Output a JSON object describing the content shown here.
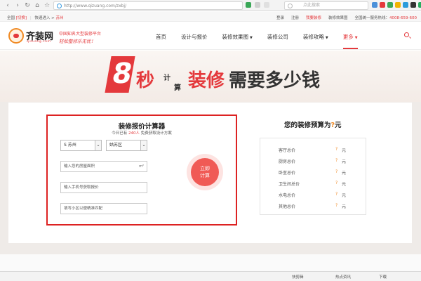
{
  "browser": {
    "url": "http://www.qizuang.com/zxbj/",
    "search_placeholder": "点此搜索"
  },
  "topbar": {
    "city": "全国",
    "switch": "[切换]",
    "quick_entry": "快速进入 >",
    "quick_city": "苏州",
    "links": [
      "登录",
      "注册",
      "我要装修",
      "装修效果图"
    ],
    "hotline_label": "全国统一服务热线：",
    "hotline": "4008-659-600"
  },
  "header": {
    "logo_name": "齐装网",
    "logo_domain": "qizuang.com",
    "slogan_line1": "中国知名大型装修平台",
    "slogan_line2": "轻松整修乐无忧！",
    "nav": [
      {
        "label": "首页",
        "dropdown": false
      },
      {
        "label": "设计与报价",
        "dropdown": false
      },
      {
        "label": "装修效果图",
        "dropdown": true
      },
      {
        "label": "装修公司",
        "dropdown": false
      },
      {
        "label": "装修攻略",
        "dropdown": true
      },
      {
        "label": "更多",
        "dropdown": true
      }
    ]
  },
  "hero": {
    "number": "8",
    "miao": "秒",
    "ji": "计",
    "suan": "算",
    "zhuangxiu": "装修",
    "rest": "需要多少钱"
  },
  "calculator": {
    "title": "装修报价计算器",
    "sub_prefix": "今日已有",
    "sub_count": "240人",
    "sub_suffix": "免费获取设计方案",
    "province": "S 苏州",
    "district": "姑苏区",
    "area_placeholder": "输入您的房屋面积",
    "area_unit": "m²",
    "phone_placeholder": "输入手机号获取报价",
    "community_placeholder": "填写小区以便精准匹配",
    "button_line1": "立即",
    "button_line2": "计算"
  },
  "budget": {
    "title_prefix": "您的装修预算为",
    "title_value": "?",
    "title_unit": "元",
    "rows": [
      {
        "label": "客厅总价",
        "value": "?",
        "unit": "元"
      },
      {
        "label": "厨房总价",
        "value": "?",
        "unit": "元"
      },
      {
        "label": "卧室总价",
        "value": "?",
        "unit": "元"
      },
      {
        "label": "卫生间总价",
        "value": "?",
        "unit": "元"
      },
      {
        "label": "水电总价",
        "value": "?",
        "unit": "元"
      },
      {
        "label": "其他总价",
        "value": "?",
        "unit": "元"
      }
    ]
  },
  "statusbar": {
    "items": [
      "快剪辑",
      "热点资讯",
      "下载"
    ]
  }
}
